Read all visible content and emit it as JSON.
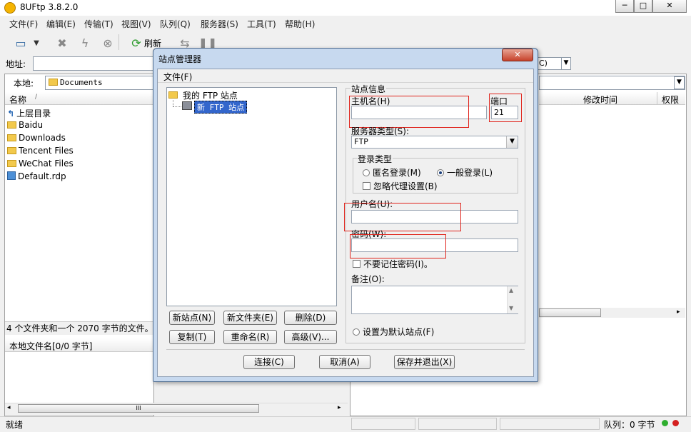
{
  "window": {
    "title": "8UFtp 3.8.2.0",
    "min": "─",
    "max": "□",
    "close": "✕"
  },
  "menu": [
    "文件(F)",
    "编辑(E)",
    "传输(T)",
    "视图(V)",
    "队列(Q)",
    "服务器(S)",
    "工具(T)",
    "帮助(H)"
  ],
  "toolbar": {
    "refresh_label": "刷新"
  },
  "address": {
    "label": "地址:"
  },
  "local": {
    "label": "本地:",
    "path": "Documents",
    "col_name": "名称",
    "sort_mark": "/",
    "items": [
      {
        "name": "上层目录",
        "icon": "up-folder-icon"
      },
      {
        "name": "Baidu",
        "icon": "folder-icon"
      },
      {
        "name": "Downloads",
        "icon": "folder-icon"
      },
      {
        "name": "Tencent Files",
        "icon": "folder-icon"
      },
      {
        "name": "WeChat Files",
        "icon": "folder-icon"
      },
      {
        "name": "Default.rdp",
        "icon": "rdp-file-icon"
      }
    ],
    "summary": "4 个文件夹和一个 2070 字节的文件。",
    "queue_header": "本地文件名[0/0 字节]",
    "scroll_mark": "III"
  },
  "remote": {
    "combo_value": "C)",
    "col_modified": "修改时间",
    "col_perm": "权限"
  },
  "status": {
    "left": "就绪",
    "queue": "队列：0 字节"
  },
  "dialog": {
    "title": "站点管理器",
    "menu_file": "文件(F)",
    "tree_root": "我的 FTP 站点",
    "tree_site": "新 FTP 站点",
    "buttons_left": [
      "新站点(N)",
      "新文件夹(E)",
      "删除(D)",
      "复制(T)",
      "重命名(R)",
      "高级(V)..."
    ],
    "site_info": "站点信息",
    "host_label": "主机名(H)",
    "host_value": "",
    "port_label": "端口",
    "port_value": "21",
    "server_type_label": "服务器类型(S):",
    "server_type_value": "FTP",
    "login_type_label": "登录类型",
    "anon_label": "匿名登录(M)",
    "normal_label": "一般登录(L)",
    "ignore_proxy_label": "忽略代理设置(B)",
    "user_label": "用户名(U):",
    "user_value": "",
    "pass_label": "密码(W):",
    "pass_value": "",
    "no_remember_label": "不要记住密码(I)。",
    "note_label": "备注(O):",
    "default_site_label": "设置为默认站点(F)",
    "connect": "连接(C)",
    "cancel": "取消(A)",
    "save_exit": "保存并退出(X)",
    "close": "✕"
  }
}
